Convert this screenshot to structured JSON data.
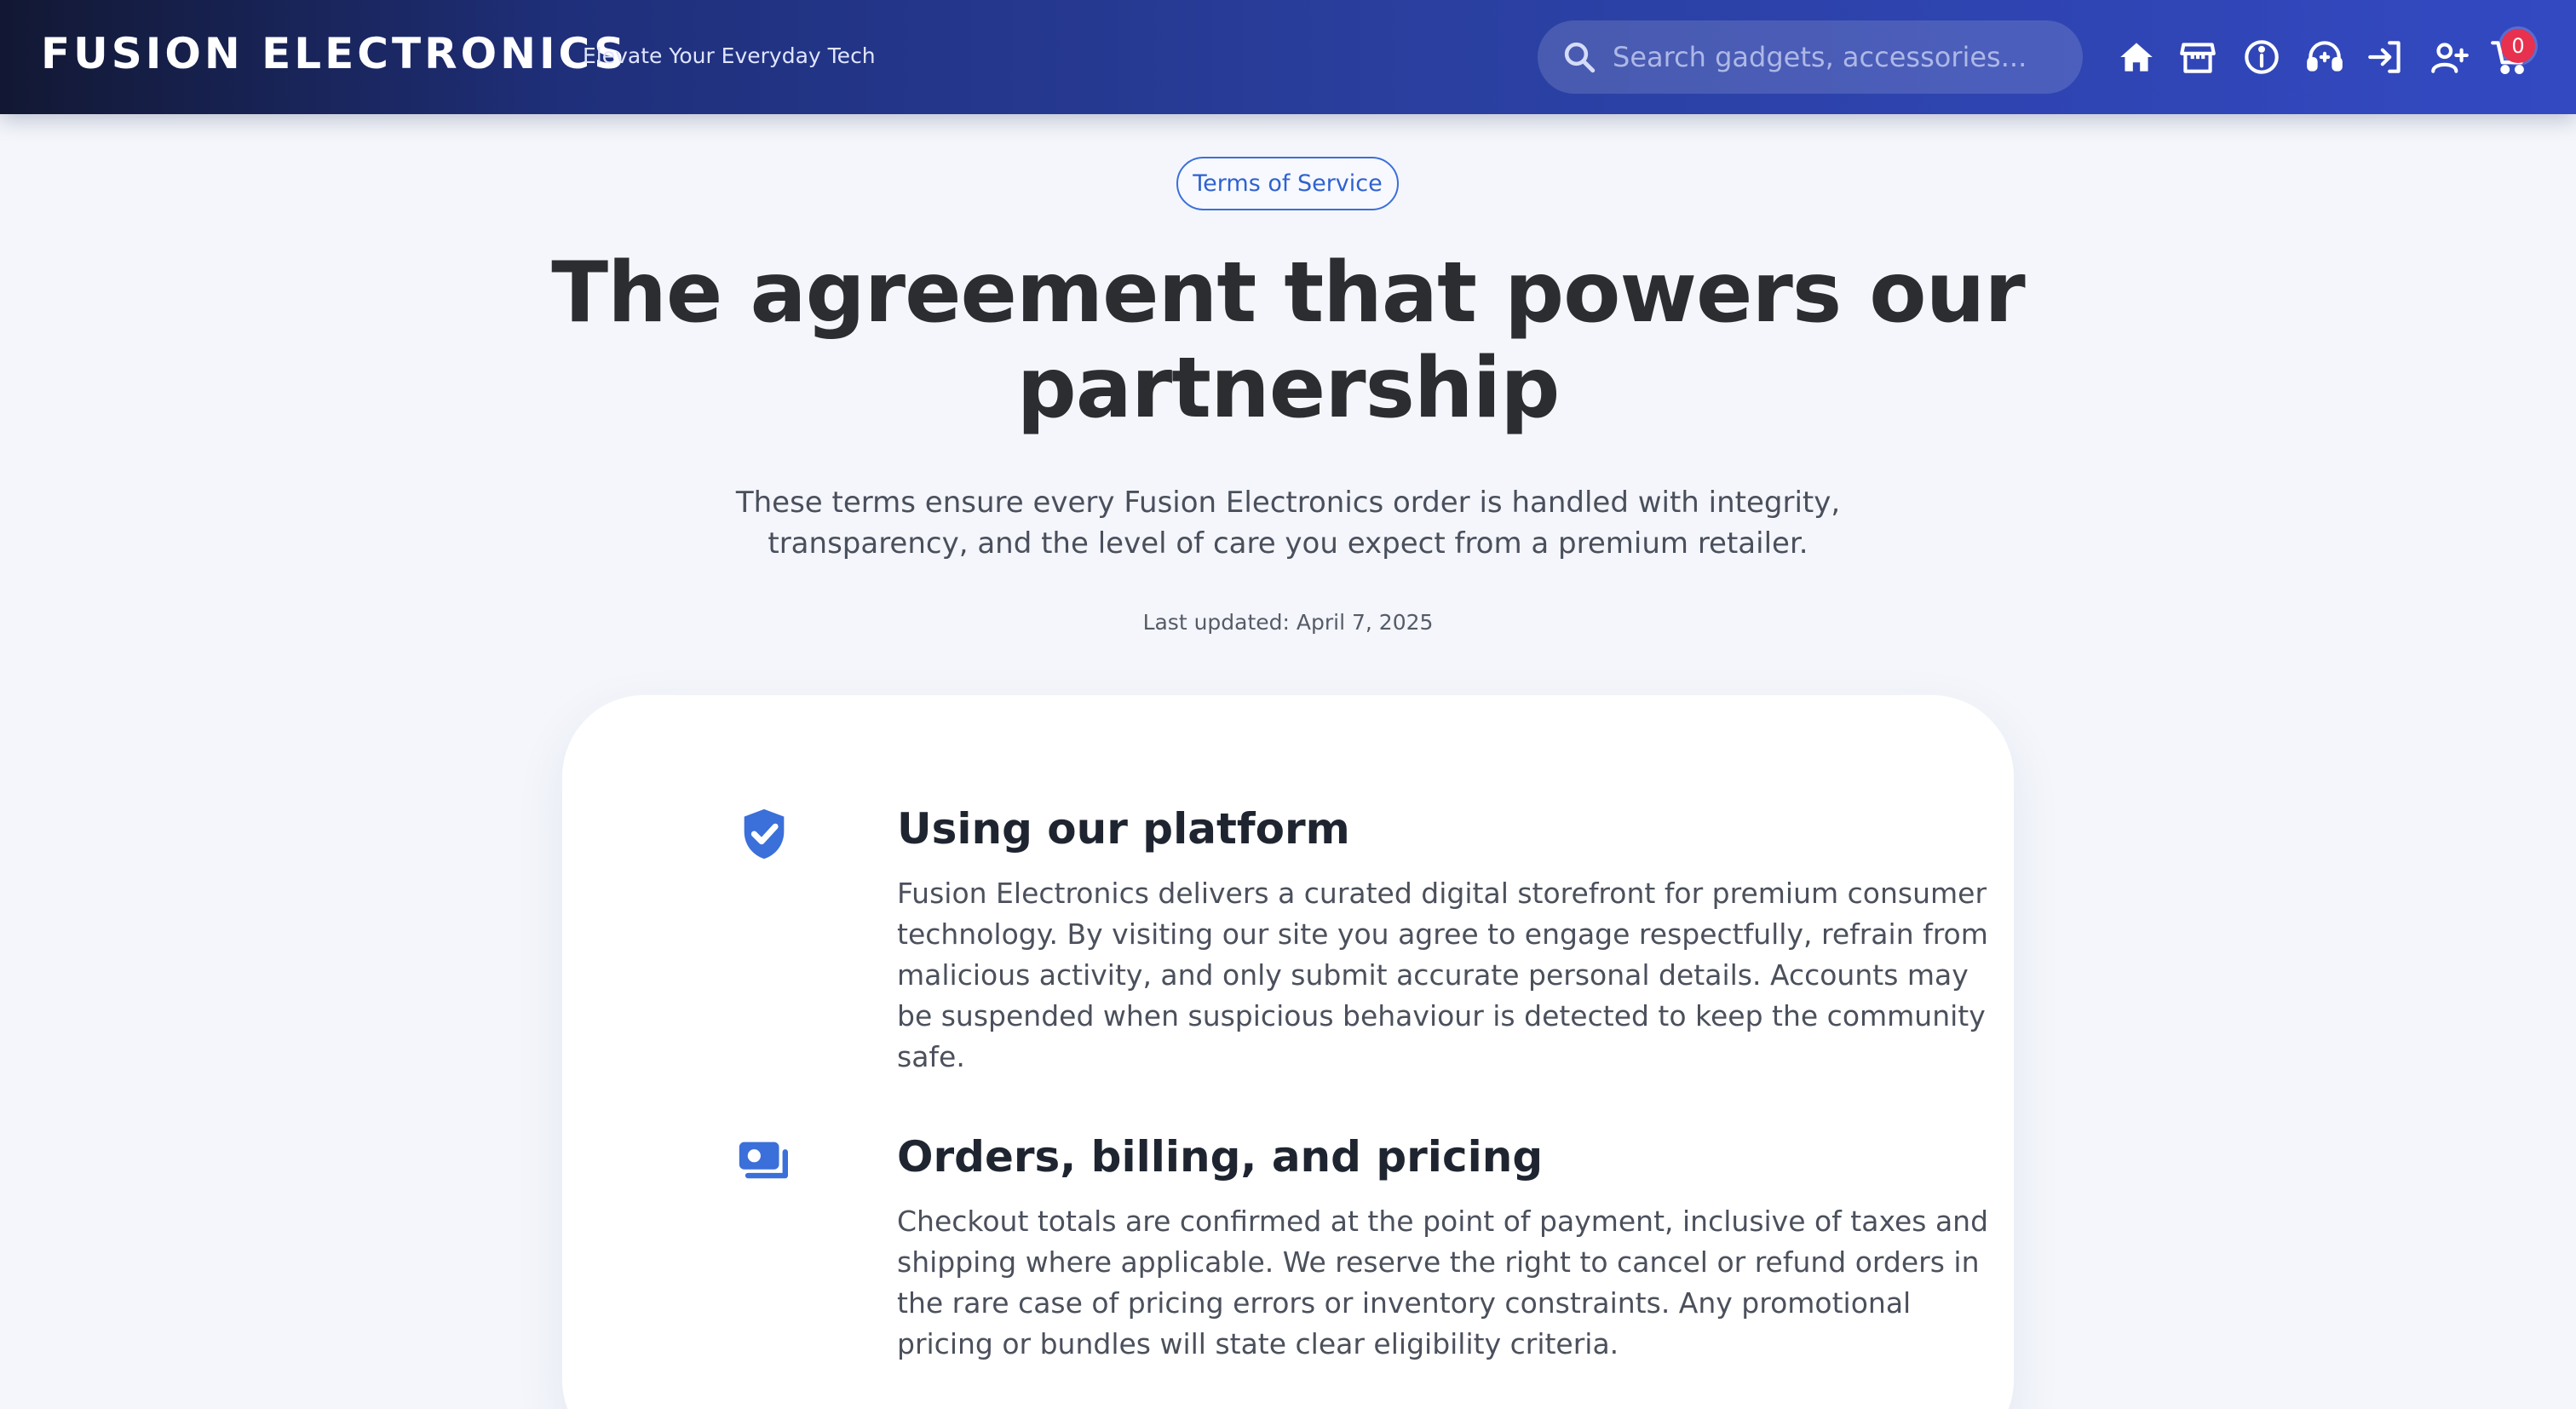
{
  "header": {
    "brand": "FUSION ELECTRONICS",
    "tagline": "Elevate Your Everyday Tech",
    "search_placeholder": "Search gadgets, accessories...",
    "nav_icons": [
      "home-icon",
      "store-icon",
      "info-icon",
      "support-icon",
      "login-icon",
      "register-icon",
      "cart-icon"
    ],
    "cart_count": "0"
  },
  "hero": {
    "pill": "Terms of Service",
    "title": "The agreement that powers our partnership",
    "subtitle": "These terms ensure every Fusion Electronics order is handled with integrity, transparency, and the level of care you expect from a premium retailer.",
    "updated": "Last updated: April 7, 2025"
  },
  "sections": [
    {
      "icon": "shield-check-icon",
      "title": "Using our platform",
      "body": "Fusion Electronics delivers a curated digital storefront for premium consumer technology. By visiting our site you agree to engage respectfully, refrain from malicious activity, and only submit accurate personal details. Accounts may be suspended when suspicious behaviour is detected to keep the community safe."
    },
    {
      "icon": "money-bills-icon",
      "title": "Orders, billing, and pricing",
      "body": "Checkout totals are confirmed at the point of payment, inclusive of taxes and shipping where applicable. We reserve the right to cancel or refund orders in the rare case of pricing errors or inventory constraints. Any promotional pricing or bundles will state clear eligibility criteria."
    }
  ],
  "colors": {
    "accent": "#3b6fd9",
    "badge": "#e8304f",
    "header_start": "#121833",
    "header_end": "#3349c2"
  }
}
